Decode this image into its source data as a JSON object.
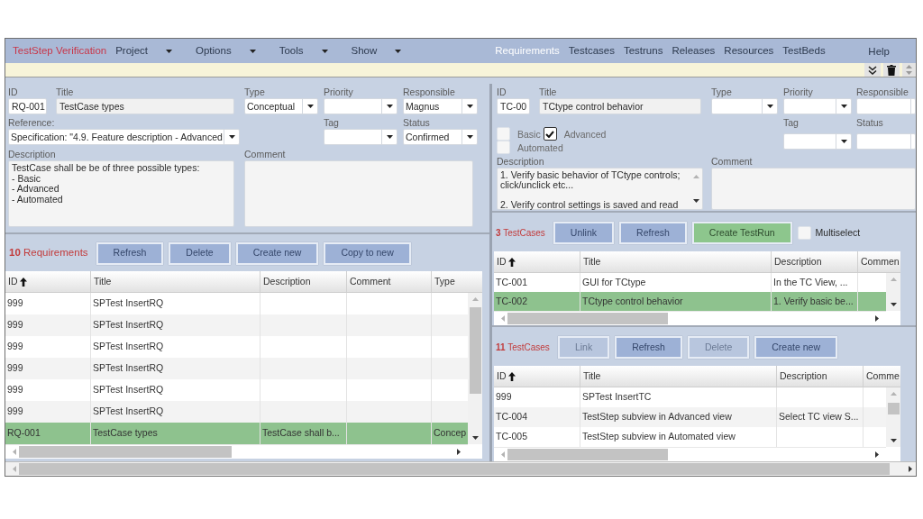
{
  "menu_bar": {
    "app_title": "TestStep Verification",
    "menus": [
      "Project",
      "Options",
      "Tools",
      "Show"
    ],
    "sections": [
      {
        "label": "Requirements",
        "selected": true
      },
      {
        "label": "Testcases",
        "selected": false
      },
      {
        "label": "Testruns",
        "selected": false
      },
      {
        "label": "Releases",
        "selected": false
      },
      {
        "label": "Resources",
        "selected": false
      },
      {
        "label": "TestBeds",
        "selected": false
      }
    ],
    "help": "Help"
  },
  "requirement_form": {
    "id": {
      "label": "ID",
      "value": "RQ-001"
    },
    "title": {
      "label": "Title",
      "value": "TestCase types"
    },
    "type": {
      "label": "Type",
      "value": "Conceptual"
    },
    "priority": {
      "label": "Priority"
    },
    "responsible": {
      "label": "Responsible",
      "value": "Magnus"
    },
    "reference": {
      "label": "Reference:",
      "value": "Specification: \"4.9. Feature description - Advanced"
    },
    "tag": {
      "label": "Tag"
    },
    "status": {
      "label": "Status",
      "value": "Confirmed"
    },
    "description": {
      "label": "Description",
      "value": "TestCase shall be be of three possible types:\n- Basic\n- Advanced\n- Automated"
    },
    "comment": {
      "label": "Comment"
    }
  },
  "requirements": {
    "count": "**10** Requirements",
    "buttons": [
      {
        "label": "Refresh"
      },
      {
        "label": "Delete"
      },
      {
        "label": "Create new"
      },
      {
        "label": "Copy to new"
      }
    ],
    "columns": [
      {
        "label": "ID",
        "sorted": true
      },
      {
        "label": "Title"
      },
      {
        "label": "Description"
      },
      {
        "label": "Comment"
      },
      {
        "label": "Type"
      }
    ],
    "rows": [
      {
        "cells": [
          "999",
          "SPTest InsertRQ",
          null,
          null,
          null
        ],
        "selected": false
      },
      {
        "cells": [
          "999",
          "SPTest InsertRQ",
          null,
          null,
          null
        ],
        "selected": false
      },
      {
        "cells": [
          "999",
          "SPTest InsertRQ",
          null,
          null,
          null
        ],
        "selected": false
      },
      {
        "cells": [
          "999",
          "SPTest InsertRQ",
          null,
          null,
          null
        ],
        "selected": false
      },
      {
        "cells": [
          "999",
          "SPTest InsertRQ",
          null,
          null,
          null
        ],
        "selected": false
      },
      {
        "cells": [
          "999",
          "SPTest InsertRQ",
          null,
          null,
          null
        ],
        "selected": false
      },
      {
        "cells": [
          "RQ-001",
          "TestCase types",
          "TestCase shall b...",
          null,
          "Concep"
        ],
        "selected": true
      }
    ]
  },
  "testcase_form": {
    "id": {
      "label": "ID",
      "value": "TC-00"
    },
    "title": {
      "label": "Title",
      "value": "TCtype control behavior"
    },
    "type": {
      "label": "Type"
    },
    "priority": {
      "label": "Priority"
    },
    "responsible": {
      "label": "Responsible"
    },
    "tag": {
      "label": "Tag"
    },
    "status": {
      "label": "Status"
    },
    "levels": [
      {
        "label": "Basic",
        "checked": false
      },
      {
        "label": "Advanced",
        "checked": true
      },
      {
        "label": "Automated",
        "checked": false
      }
    ],
    "description": {
      "label": "Description",
      "value": "1. Verify basic behavior of TCtype controls;\nclick/unclick etc...\n\n2. Verify control settings is saved and read"
    },
    "comment": {
      "label": "Comment"
    }
  },
  "linked_testcases": {
    "count": "**3** TestCases",
    "buttons": [
      {
        "label": "Unlink",
        "kind": "normal"
      },
      {
        "label": "Refresh",
        "kind": "normal"
      },
      {
        "label": "Create TestRun",
        "kind": "accent"
      }
    ],
    "multiselect": {
      "label": "Multiselect",
      "checked": false
    },
    "columns": [
      {
        "label": "ID",
        "sorted": true
      },
      {
        "label": "Title"
      },
      {
        "label": "Description"
      },
      {
        "label": "Commen"
      }
    ],
    "rows": [
      {
        "cells": [
          "TC-001",
          "GUI for TCtype",
          "In the TC View, ...",
          null
        ],
        "selected": false
      },
      {
        "cells": [
          "TC-002",
          "TCtype control behavior",
          "1. Verify basic be...",
          null
        ],
        "selected": true
      }
    ]
  },
  "all_testcases": {
    "count": "**11** TestCases",
    "buttons": [
      {
        "label": "Link",
        "disabled": true
      },
      {
        "label": "Refresh",
        "disabled": false
      },
      {
        "label": "Delete",
        "disabled": true
      },
      {
        "label": "Create new",
        "disabled": false
      }
    ],
    "columns": [
      {
        "label": "ID",
        "sorted": true
      },
      {
        "label": "Title"
      },
      {
        "label": "Description"
      },
      {
        "label": "Comme"
      }
    ],
    "rows": [
      {
        "cells": [
          "999",
          "SPTest InsertTC",
          null,
          null
        ],
        "selected": false
      },
      {
        "cells": [
          "TC-004",
          "TestStep subview in Advanced view",
          "Select TC view S...",
          null
        ],
        "selected": false
      },
      {
        "cells": [
          "TC-005",
          "TestStep subview in Automated view",
          null,
          null
        ],
        "selected": false
      }
    ]
  }
}
